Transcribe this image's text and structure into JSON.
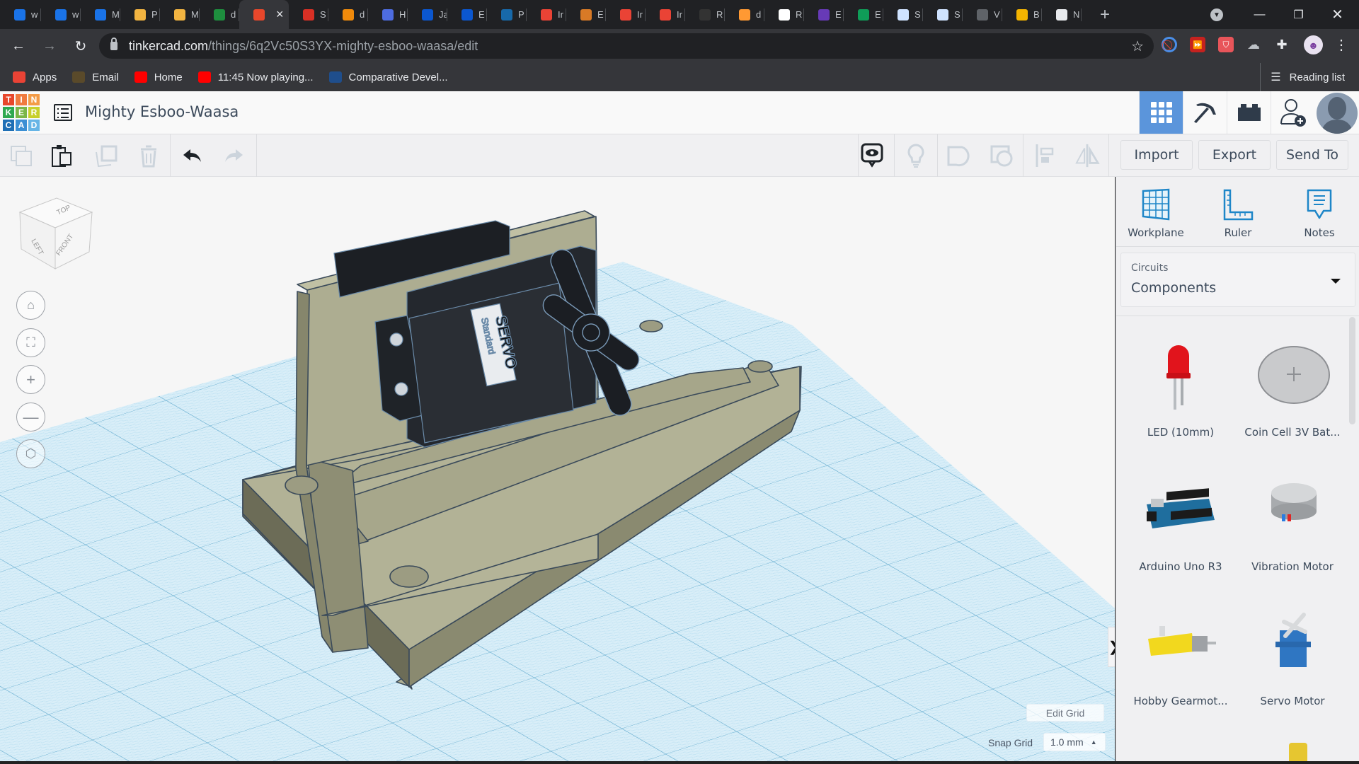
{
  "browser": {
    "tabs": [
      {
        "label": "w",
        "icon": "tinkercad-t-icon",
        "color": "#1a73e8"
      },
      {
        "label": "w",
        "icon": "tinkercad-t-icon",
        "color": "#1a73e8"
      },
      {
        "label": "M",
        "icon": "tinkercad-t-icon",
        "color": "#1a73e8"
      },
      {
        "label": "P",
        "icon": "robot-icon",
        "color": "#f2b441"
      },
      {
        "label": "M",
        "icon": "robot-icon",
        "color": "#f2b441"
      },
      {
        "label": "d",
        "icon": "plus-doc-icon",
        "color": "#1e8e3e"
      },
      {
        "label": "",
        "icon": "tinkercad-icon",
        "color": "#e8472b",
        "active": true
      },
      {
        "label": "S",
        "icon": "i-icon",
        "color": "#d93025"
      },
      {
        "label": "d",
        "icon": "diagram-icon",
        "color": "#f08a0b"
      },
      {
        "label": "H",
        "icon": "c-icon",
        "color": "#4d6ce0"
      },
      {
        "label": "Ja",
        "icon": "c-icon",
        "color": "#0b57d0"
      },
      {
        "label": "E",
        "icon": "c-icon",
        "color": "#0b57d0"
      },
      {
        "label": "P",
        "icon": "play-icon",
        "color": "#1769aa"
      },
      {
        "label": "Ir",
        "icon": "gmail-icon",
        "color": "#ea4335"
      },
      {
        "label": "E",
        "icon": "e-icon",
        "color": "#d97a26"
      },
      {
        "label": "Ir",
        "icon": "gmail-icon",
        "color": "#ea4335"
      },
      {
        "label": "Ir",
        "icon": "gmail-icon",
        "color": "#ea4335"
      },
      {
        "label": "R",
        "icon": "badge-icon",
        "color": "#333333"
      },
      {
        "label": "d",
        "icon": "flag-icon",
        "color": "#ff9933"
      },
      {
        "label": "R",
        "icon": "dots-grid-icon",
        "color": "#ffffff"
      },
      {
        "label": "E",
        "icon": "list-icon",
        "color": "#673ab7"
      },
      {
        "label": "E",
        "icon": "s-icon",
        "color": "#0f9d58"
      },
      {
        "label": "S",
        "icon": "bulb-icon",
        "color": "#cfe3ff"
      },
      {
        "label": "S",
        "icon": "bulb-icon",
        "color": "#cfe3ff"
      },
      {
        "label": "V",
        "icon": "shield-icon",
        "color": "#5f6368"
      },
      {
        "label": "B",
        "icon": "pencil-icon",
        "color": "#f4b400"
      },
      {
        "label": "N",
        "icon": "chrome-icon",
        "color": "#e8eaed"
      }
    ],
    "active_tab_close": "×",
    "new_tab": "+",
    "url_host": "tinkercad.com",
    "url_path": "/things/6q2Vc50S3YX-mighty-esboo-waasa/edit",
    "bookmarks": [
      {
        "label": "Apps",
        "icon": "apps-grid-icon",
        "color": "#ea4335"
      },
      {
        "label": "Email",
        "icon": "blackboard-icon",
        "color": "#5a4a2a"
      },
      {
        "label": "Home",
        "icon": "youtube-icon",
        "color": "#ff0000"
      },
      {
        "label": "11:45 Now playing...",
        "icon": "youtube-icon",
        "color": "#ff0000"
      },
      {
        "label": "Comparative Devel...",
        "icon": "bookmark-site-icon",
        "color": "#1f4e8c"
      }
    ],
    "reading_list": "Reading list"
  },
  "app": {
    "logo_letters": [
      "T",
      "I",
      "N",
      "K",
      "E",
      "R",
      "C",
      "A",
      "D"
    ],
    "logo_colors": [
      "#e8472b",
      "#f07b3f",
      "#f39b47",
      "#2fa84f",
      "#7ab648",
      "#c7d02c",
      "#1f6fb5",
      "#3b8fd4",
      "#67b5e6"
    ],
    "design_title": "Mighty Esboo-Waasa",
    "accent": "#5b95db"
  },
  "toolbar": {
    "import_label": "Import",
    "export_label": "Export",
    "send_to_label": "Send To"
  },
  "viewcube": {
    "top": "TOP",
    "left": "LEFT",
    "front": "FRONT"
  },
  "workspace": {
    "edit_grid_label": "Edit Grid",
    "snap_grid_label": "Snap Grid",
    "snap_grid_value": "1.0 mm",
    "servo_label_main": "SERVO",
    "servo_label_sub": "Standard"
  },
  "panel": {
    "tools": [
      {
        "label": "Workplane",
        "icon": "workplane-icon"
      },
      {
        "label": "Ruler",
        "icon": "ruler-icon"
      },
      {
        "label": "Notes",
        "icon": "notes-icon"
      }
    ],
    "category_label": "Circuits",
    "category_value": "Components",
    "components": [
      {
        "label": "LED (10mm)"
      },
      {
        "label": "Coin Cell 3V Bat..."
      },
      {
        "label": "Arduino Uno R3"
      },
      {
        "label": "Vibration Motor"
      },
      {
        "label": "Hobby Gearmot..."
      },
      {
        "label": "Servo Motor"
      }
    ]
  }
}
